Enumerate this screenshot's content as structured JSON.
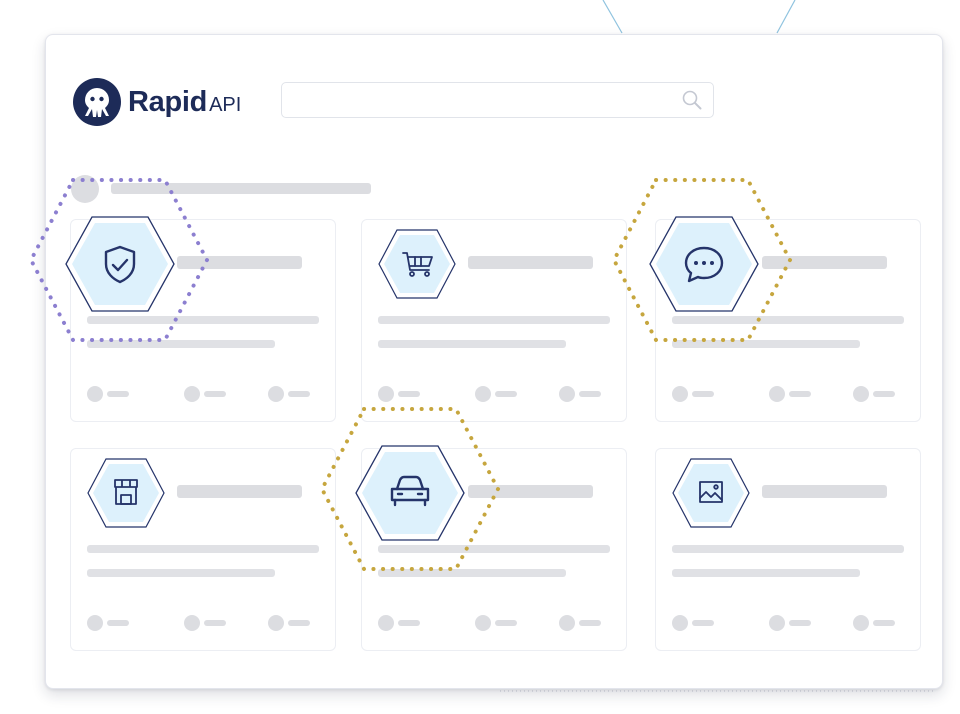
{
  "brand": {
    "name": "Rapid",
    "suffix": "API"
  },
  "search": {
    "value": "",
    "placeholder": ""
  },
  "colors": {
    "brand_navy": "#1d2b58",
    "highlight_purple": "#8c7fd0",
    "highlight_gold": "#c6a63e",
    "icon_fill": "#ddf1fc",
    "icon_stroke": "#25346a"
  },
  "cards": [
    {
      "icon": "shield-check-icon",
      "highlight": "purple"
    },
    {
      "icon": "shopping-cart-icon",
      "highlight": "none"
    },
    {
      "icon": "chat-bubble-icon",
      "highlight": "gold"
    },
    {
      "icon": "storefront-icon",
      "highlight": "none"
    },
    {
      "icon": "car-icon",
      "highlight": "gold"
    },
    {
      "icon": "image-icon",
      "highlight": "none"
    }
  ]
}
